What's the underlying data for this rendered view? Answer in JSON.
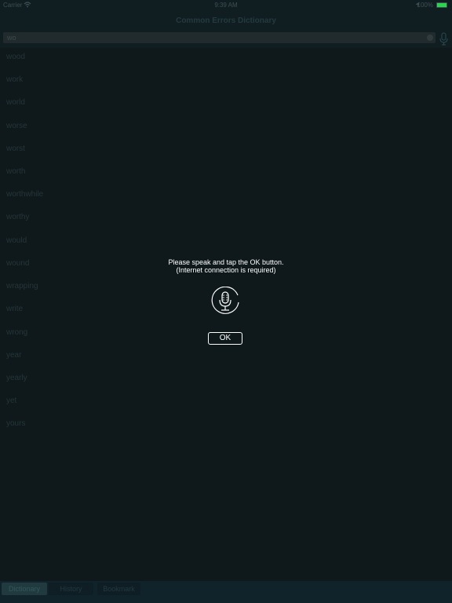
{
  "status_bar": {
    "carrier": "Carrier",
    "time": "9:39 AM",
    "battery": "100%",
    "battery_color": "#2bd44f"
  },
  "nav": {
    "title": "Common Errors Dictionary"
  },
  "search": {
    "value": "wo",
    "placeholder": ""
  },
  "list": {
    "items": [
      "wood",
      "work",
      "world",
      "worse",
      "worst",
      "worth",
      "worthwhile",
      "worthy",
      "would",
      "wound",
      "wrapping",
      "write",
      "wrong",
      "year",
      "yearly",
      "yet",
      "yours"
    ]
  },
  "voice_dialog": {
    "line1": "Please speak and tap the OK button.",
    "line2": "(Internet connection is required)",
    "ok_label": "OK",
    "icon": "microphone-icon"
  },
  "tabs": {
    "dictionary": "Dictionary",
    "history": "History",
    "bookmark": "Bookmark"
  },
  "colors": {
    "background": "#0f191c",
    "accent": "#1a5a66"
  }
}
